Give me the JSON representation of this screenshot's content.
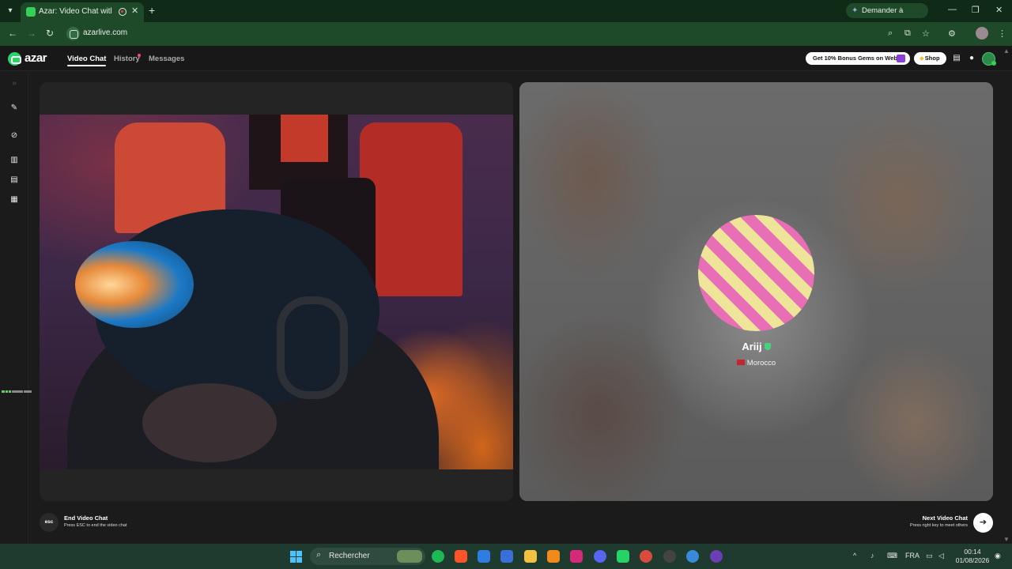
{
  "browser": {
    "tab_title": "Azar: Video Chat with New",
    "new_tab_symbol": "+",
    "gemini_label": "Demander à Gemini",
    "url": "azarlive.com"
  },
  "app": {
    "logo_text": "azar",
    "nav": [
      {
        "label": "Video Chat",
        "active": true
      },
      {
        "label": "History",
        "active": false,
        "has_dot": true
      },
      {
        "label": "Messages",
        "active": false
      }
    ],
    "promo_label": "Get 10% Bonus Gems on Web!",
    "shop_label": "Shop"
  },
  "peer": {
    "name": "Ariij",
    "verified": true,
    "country": "Morocco",
    "avatar_colors": [
      "#e86fb5",
      "#efe59a"
    ]
  },
  "controls": {
    "end_key": "esc",
    "end_title": "End Video Chat",
    "end_sub": "Press ESC to end the video chat",
    "next_title": "Next Video Chat",
    "next_sub": "Press right key to meet others"
  },
  "taskbar": {
    "search_placeholder": "Rechercher",
    "language": "FRA",
    "time": "00:14",
    "date": "01/08/2026"
  },
  "colors": {
    "chrome_green": "#1f4a2a",
    "azar_green": "#2bd46b",
    "taskbar": "#1f3a2f"
  }
}
